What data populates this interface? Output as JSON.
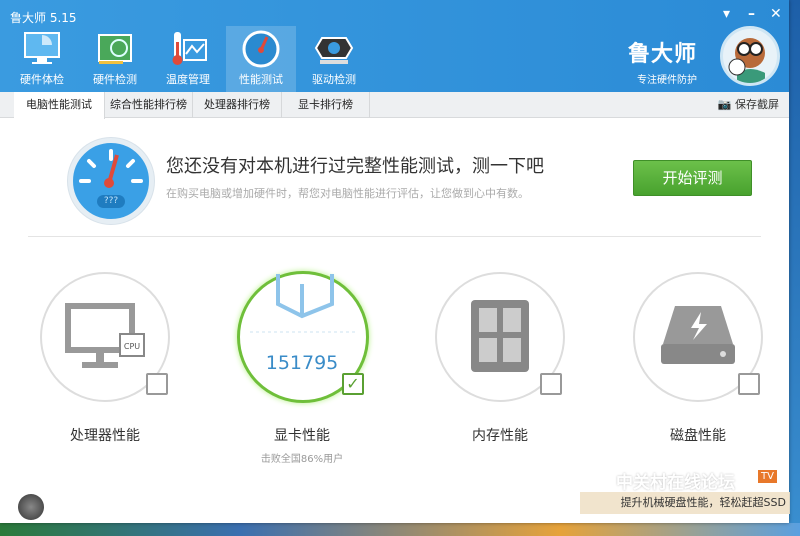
{
  "window": {
    "title": "鲁大师 5.15",
    "controls": [
      "menu",
      "minimize",
      "close"
    ]
  },
  "nav": [
    {
      "label": "硬件体检",
      "icon": "monitor-radar-icon"
    },
    {
      "label": "硬件检测",
      "icon": "circuit-board-icon"
    },
    {
      "label": "温度管理",
      "icon": "thermometer-icon"
    },
    {
      "label": "性能测试",
      "icon": "speedometer-icon",
      "active": true
    },
    {
      "label": "驱动检测",
      "icon": "gear-box-icon"
    }
  ],
  "brand": {
    "name": "鲁大师",
    "slogan": "专注硬件防护"
  },
  "subtabs": [
    "电脑性能测试",
    "综合性能排行榜",
    "处理器排行榜",
    "显卡排行榜"
  ],
  "save_screenshot": "保存截屏",
  "banner": {
    "title": "您还没有对本机进行过完整性能测试，测一下吧",
    "subtitle": "在购买电脑或增加硬件时，帮您对电脑性能进行评估，让您做到心中有数。",
    "gauge_label": "???",
    "button": "开始评测"
  },
  "cards": [
    {
      "label": "处理器性能",
      "checked": false,
      "chip": "CPU"
    },
    {
      "label": "显卡性能",
      "checked": true,
      "score": "151795",
      "rank": "击败全国86%用户"
    },
    {
      "label": "内存性能",
      "checked": false
    },
    {
      "label": "磁盘性能",
      "checked": false
    }
  ],
  "ad": {
    "watermark": "中关村在线论坛",
    "badge": "TV",
    "text": "提升机械硬盘性能，轻松赶超SSD"
  },
  "colors": {
    "header": "#2b8bd6",
    "accent_green": "#48a22e",
    "score": "#3a8cc8"
  }
}
